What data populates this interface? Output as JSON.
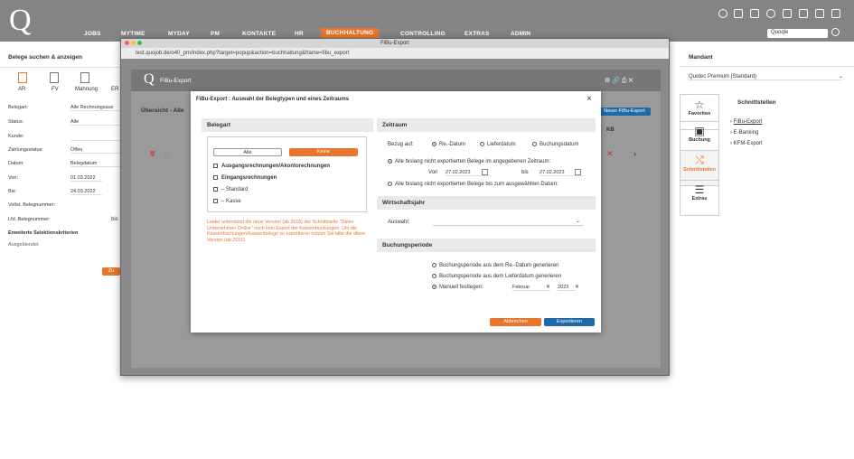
{
  "header": {
    "logo": "Q",
    "nav": [
      "JOBS",
      "MYTIME",
      "MYDAY",
      "PM",
      "KONTAKTE",
      "HR",
      "BUCHHALTUNG",
      "CONTROLLING",
      "EXTRAS",
      "ADMIN"
    ],
    "active_nav": "BUCHHALTUNG",
    "search_value": "Quoqle",
    "accent": "#e8762c"
  },
  "left": {
    "title": "Belege suchen & anzeigen",
    "toolbar": [
      "AR",
      "FV",
      "Mahnung",
      "ER"
    ],
    "fields": [
      {
        "label": "Belegart:",
        "value": "Alle Rechnungsaus"
      },
      {
        "label": "Status:",
        "value": "Alle"
      },
      {
        "label": "Kunde:",
        "value": ""
      },
      {
        "label": "Zahlungsstatus:",
        "value": "Offen"
      },
      {
        "label": "Datum:",
        "value": "Belegdatum"
      },
      {
        "label": "Von:",
        "value": "01.03.2022"
      },
      {
        "label": "Bis:",
        "value": "24.03.2022"
      },
      {
        "label": "Vollst. Belegnummer:",
        "value": ""
      },
      {
        "label": "Lfd. Belegnummer:",
        "value": "bis"
      }
    ],
    "extended": "Erweiterte Selektionskriterien",
    "hidden": "Ausgeblendet",
    "search_btn": "Zu"
  },
  "right": {
    "mandant_title": "Mandant",
    "mandant_value": "Quotec Premium (Standard)",
    "schnitt_title": "Schnittstellen",
    "side": [
      "Favoriten",
      "Buchung",
      "Schnittstellen",
      "Extras"
    ],
    "links": [
      "FiBu-Export",
      "E-Banking",
      "KFM-Export"
    ]
  },
  "popup": {
    "title": "FiBu-Export",
    "url": "test.quojob.de/o40_pm/index.php?target=popup&action=buchhaltung&frame=fibu_export",
    "inner_title": "FiBu-Export",
    "overview": "Übersicht - Alle",
    "new_btn": "Neuer FiBu-Export",
    "kb": "KB"
  },
  "dialog": {
    "title": "FiBu-Export : Auswahl der Belegtypen und eines Zeitraums",
    "belegart": {
      "title": "Belegart",
      "btn_alle": "Alle",
      "btn_keine": "Keine",
      "items": [
        "Ausgangsrechnungen/Akontorechnungen",
        "Eingangsrechnungen",
        "Standard",
        "Kasse"
      ],
      "warning": "Leider unterstützt die neue Version (ab 2018) der Schnittstelle \"Datev Unternehmen Online\" noch kein Export der Kassenbuchungen. Um die Kassenbuchungen/Kassenbelege zu exportieren nutzen Sie bitte die ältere Version (ab 2015)."
    },
    "zeitraum": {
      "title": "Zeitraum",
      "bezug_label": "Bezug auf:",
      "bezug": [
        "Re.-Datum",
        "Lieferdatum",
        "Buchungsdatum"
      ],
      "opt1": "Alle bislang nicht exportierten Belege im angegebenen Zeitraum:",
      "von_label": "Von",
      "von": "27.02.2023",
      "bis_label": "bis",
      "bis": "27.02.2023",
      "opt2": "Alle bislang nicht exportierten Belege bis zum ausgewählten Datum:"
    },
    "wj": {
      "title": "Wirtschaftsjahr",
      "label": "Auswahl:"
    },
    "bp": {
      "title": "Buchungsperiode",
      "opts": [
        "Buchungsperiode aus dem Re.-Datum generieren",
        "Buchungsperiode aus dem Lieferdatum generieren",
        "Manuell festlegen:"
      ],
      "month": "Februar",
      "year": "2023"
    },
    "cancel": "Abbrechen",
    "export": "Exportieren"
  }
}
